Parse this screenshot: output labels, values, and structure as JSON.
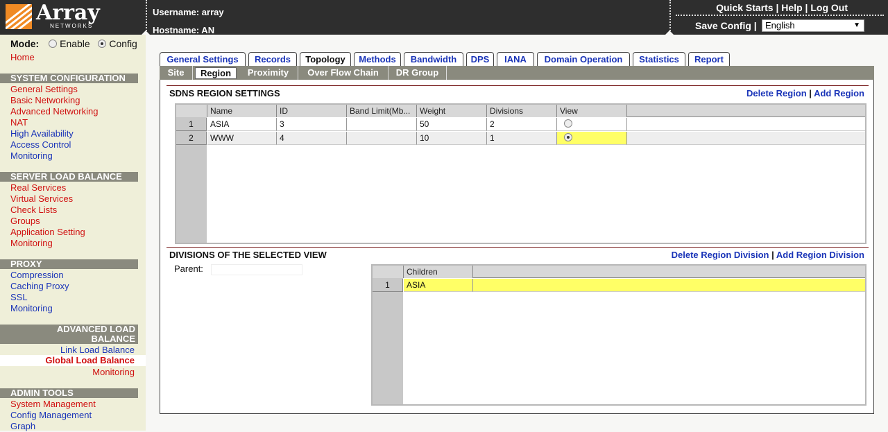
{
  "header": {
    "logo_text": "Array",
    "logo_sub": "NETWORKS",
    "username_label": "Username: array",
    "hostname_label": "Hostname: AN",
    "links": [
      "Quick Starts",
      "Help",
      "Log Out"
    ],
    "save_config": "Save Config",
    "language": "English"
  },
  "sidebar": {
    "mode_label": "Mode:",
    "mode_enable": "Enable",
    "mode_config": "Config",
    "home": "Home",
    "sections": [
      {
        "title": "SYSTEM CONFIGURATION",
        "items": [
          "General Settings",
          "Basic Networking",
          "Advanced Networking",
          "NAT",
          "High Availability",
          "Access Control",
          "Monitoring"
        ]
      },
      {
        "title": "SERVER LOAD BALANCE",
        "items": [
          "Real Services",
          "Virtual Services",
          "Check Lists",
          "Groups",
          "Application Setting",
          "Monitoring"
        ]
      },
      {
        "title": "PROXY",
        "items": [
          "Compression",
          "Caching Proxy",
          "SSL",
          "Monitoring"
        ]
      },
      {
        "title_line1": "ADVANCED LOAD",
        "title_line2": "BALANCE",
        "items": [
          "Link Load Balance",
          "Global Load Balance",
          "Monitoring"
        ]
      },
      {
        "title": "ADMIN TOOLS",
        "items": [
          "System Management",
          "Config Management",
          "Graph"
        ]
      }
    ]
  },
  "tabs": [
    "General Settings",
    "Records",
    "Topology",
    "Methods",
    "Bandwidth",
    "DPS",
    "IANA",
    "Domain Operation",
    "Statistics",
    "Report"
  ],
  "subtabs": [
    "Site",
    "Region",
    "Proximity",
    "Over Flow Chain",
    "DR Group"
  ],
  "region_panel": {
    "title": "SDNS REGION SETTINGS",
    "delete": "Delete Region",
    "add": "Add Region",
    "columns": [
      "Name",
      "ID",
      "Band Limit(Mb...",
      "Weight",
      "Divisions",
      "View"
    ],
    "rows": [
      {
        "num": "1",
        "name": "ASIA",
        "id": "3",
        "band": "",
        "weight": "50",
        "divisions": "2",
        "view_selected": false
      },
      {
        "num": "2",
        "name": "WWW",
        "id": "4",
        "band": "",
        "weight": "10",
        "divisions": "1",
        "view_selected": true
      }
    ]
  },
  "divisions_panel": {
    "title": "DIVISIONS OF THE SELECTED VIEW",
    "delete": "Delete Region Division",
    "add": "Add Region Division",
    "parent_label": "Parent:",
    "columns": [
      "Children"
    ],
    "rows": [
      {
        "num": "1",
        "child": "ASIA"
      }
    ]
  },
  "colors": {
    "link_blue": "#1a34b8",
    "link_red": "#d01010",
    "section_gray": "#8a8a7e",
    "sidebar_bg": "#efefd9",
    "highlight": "#ffff66",
    "logo_orange": "#f08a24"
  }
}
